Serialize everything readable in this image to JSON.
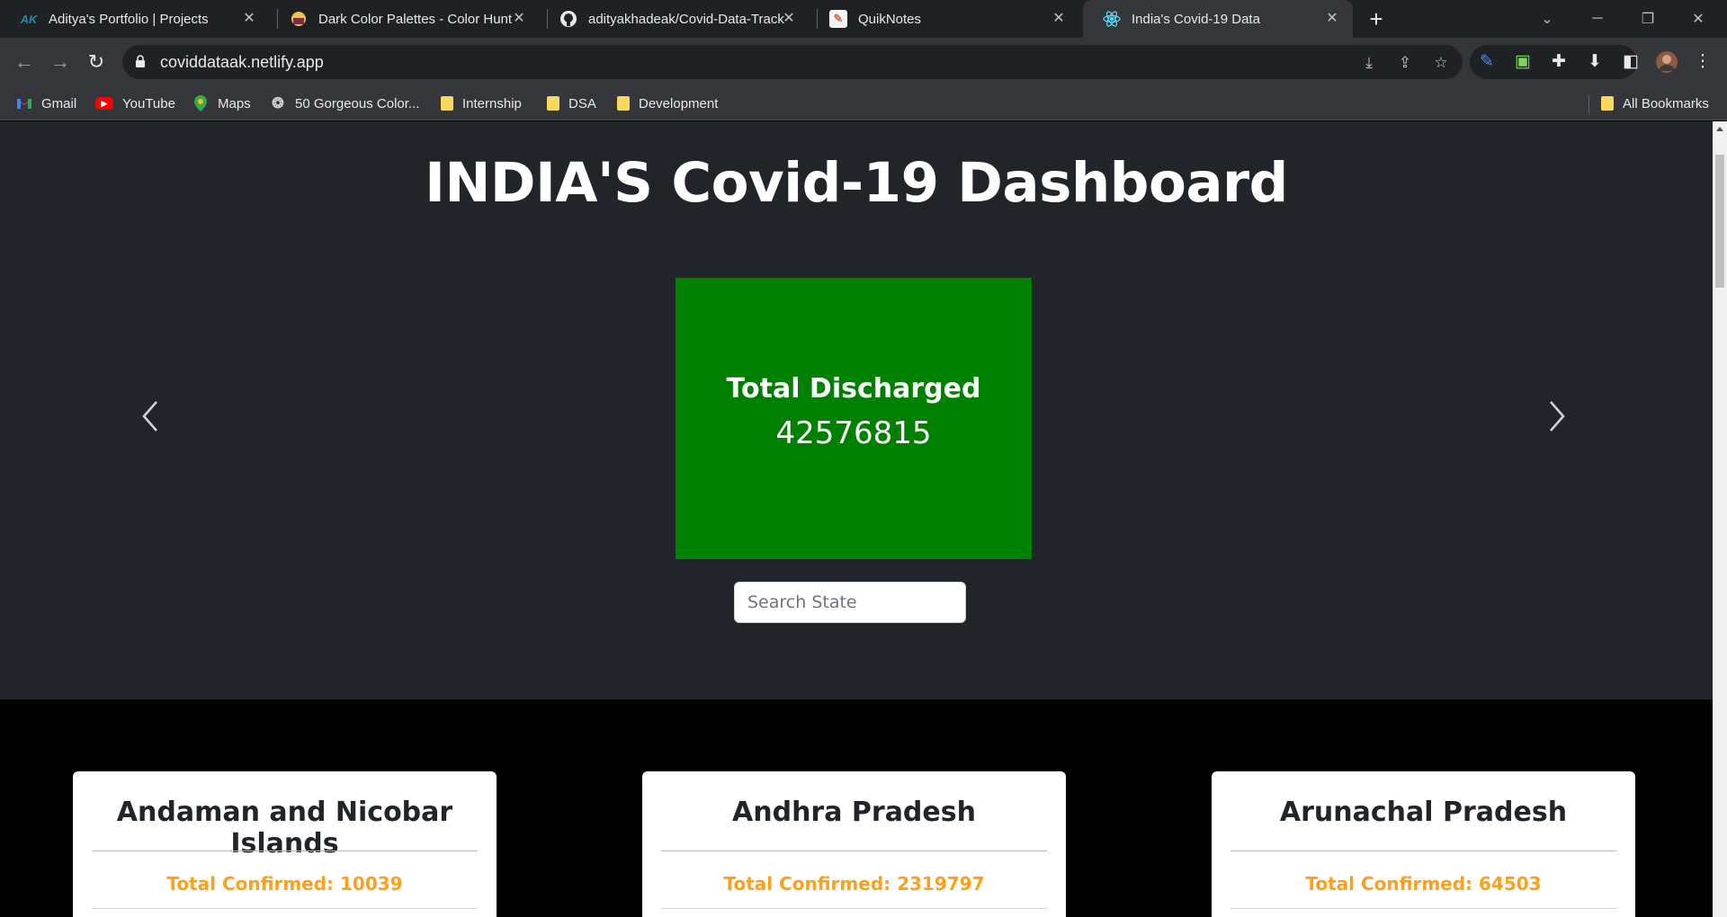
{
  "tabs": [
    {
      "title": "Aditya's Portfolio | Projects",
      "favicon": "AK",
      "favicon_color": "#1a8fa3"
    },
    {
      "title": "Dark Color Palettes - Color Hunt",
      "favicon": "●",
      "favicon_color": "#f2c14e"
    },
    {
      "title": "adityakhadeak/Covid-Data-Track",
      "favicon": "⬤",
      "favicon_color": "#e8eaed"
    },
    {
      "title": "QuikNotes",
      "favicon": "✎",
      "favicon_color": "#e06c5a"
    },
    {
      "title": "India's Covid-19 Data",
      "favicon": "⚛",
      "favicon_color": "#61dafb"
    }
  ],
  "address_bar": {
    "url": "coviddataak.netlify.app"
  },
  "bookmarks": [
    {
      "label": "Gmail",
      "icon": "gmail-icon"
    },
    {
      "label": "YouTube",
      "icon": "youtube-icon"
    },
    {
      "label": "Maps",
      "icon": "maps-icon"
    },
    {
      "label": "50 Gorgeous Color...",
      "icon": "palette-icon"
    },
    {
      "label": "Internship",
      "icon": "folder-icon"
    },
    {
      "label": "DSA",
      "icon": "folder-icon"
    },
    {
      "label": "Development",
      "icon": "folder-icon"
    }
  ],
  "all_bookmarks": "All Bookmarks",
  "page": {
    "title": "INDIA'S Covid-19 Dashboard",
    "carousel": {
      "label": "Total Discharged",
      "value": "42576815",
      "color": "#008000"
    },
    "search": {
      "placeholder": "Search State"
    },
    "states": [
      {
        "name": "Andaman and Nicobar Islands",
        "confirmed": "Total Confirmed: 10039"
      },
      {
        "name": "Andhra Pradesh",
        "confirmed": "Total Confirmed: 2319797"
      },
      {
        "name": "Arunachal Pradesh",
        "confirmed": "Total Confirmed: 64503"
      }
    ]
  },
  "colors": {
    "hero_bg": "#212529",
    "confirmed_text": "#ff9f1a",
    "card_green": "#008000"
  }
}
